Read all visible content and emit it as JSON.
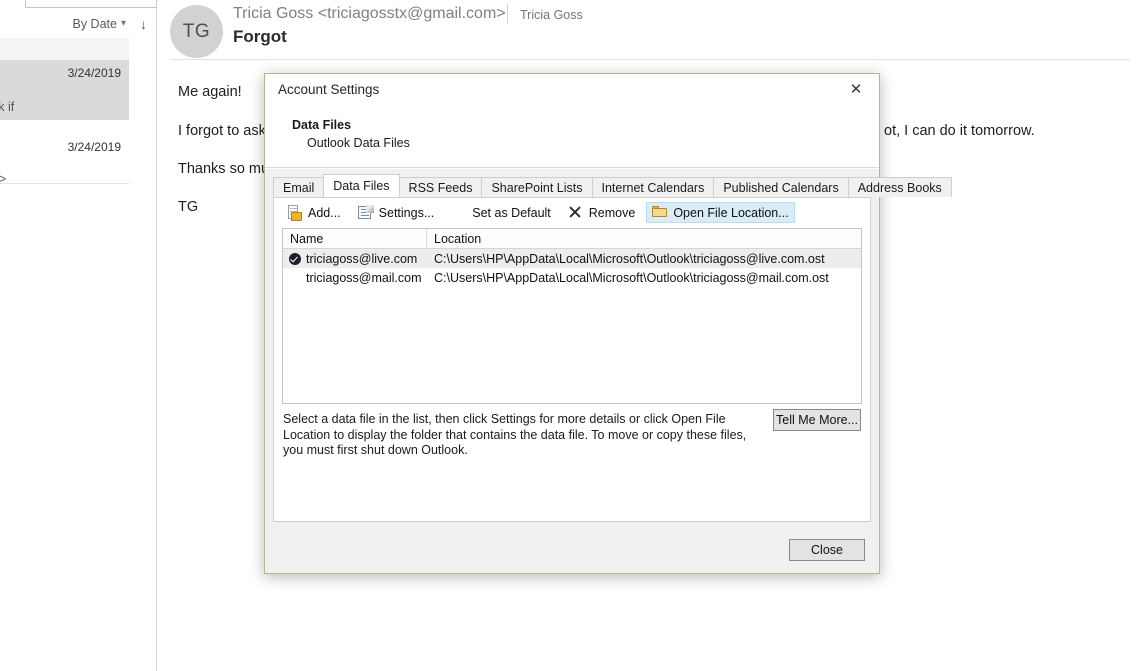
{
  "message_list": {
    "sort": {
      "label": "By Date",
      "chevron_icon": "chevron-down-icon",
      "direction_icon": "sort-descending-arrow-icon"
    },
    "items": [
      {
        "date": "3/24/2019",
        "snippet": "sk if",
        "selected": true
      },
      {
        "date": "3/24/2019",
        "snippet": "d>",
        "selected": false
      }
    ]
  },
  "reading_pane": {
    "avatar_initials": "TG",
    "from": "Tricia Goss <triciagosstx@gmail.com>",
    "from_short": "Tricia Goss",
    "subject": "Forgot",
    "body_lines": [
      "Me again!",
      "I forgot to ask",
      "Thanks so muc",
      "TG"
    ],
    "occluded_tail": "ot, I can do it tomorrow."
  },
  "dialog": {
    "title": "Account Settings",
    "close_icon": "close-icon",
    "banner": {
      "heading": "Data Files",
      "subtext": "Outlook Data Files"
    },
    "tabs": [
      {
        "label": "Email",
        "active": false
      },
      {
        "label": "Data Files",
        "active": true
      },
      {
        "label": "RSS Feeds",
        "active": false
      },
      {
        "label": "SharePoint Lists",
        "active": false
      },
      {
        "label": "Internet Calendars",
        "active": false
      },
      {
        "label": "Published Calendars",
        "active": false
      },
      {
        "label": "Address Books",
        "active": false
      }
    ],
    "commands": [
      {
        "label": "Add...",
        "icon": "add-data-file-icon",
        "highlight": false
      },
      {
        "label": "Settings...",
        "icon": "settings-page-icon",
        "highlight": false
      },
      {
        "label": "Set as Default",
        "icon": "check-circle-icon",
        "highlight": false
      },
      {
        "label": "Remove",
        "icon": "remove-x-icon",
        "highlight": false
      },
      {
        "label": "Open File Location...",
        "icon": "folder-icon",
        "highlight": true
      }
    ],
    "list": {
      "columns": [
        "Name",
        "Location"
      ],
      "rows": [
        {
          "name": "triciagoss@live.com",
          "location": "C:\\Users\\HP\\AppData\\Local\\Microsoft\\Outlook\\triciagoss@live.com.ost",
          "is_default": true,
          "selected": true
        },
        {
          "name": "triciagoss@mail.com",
          "location": "C:\\Users\\HP\\AppData\\Local\\Microsoft\\Outlook\\triciagoss@mail.com.ost",
          "is_default": false,
          "selected": false
        }
      ]
    },
    "help_text": "Select a data file in the list, then click Settings for more details or click Open File Location to display the folder that contains the data file. To move or copy these files, you must first shut down Outlook.",
    "tell_me_more_label": "Tell Me More...",
    "close_label": "Close",
    "accent_border_color": "#a6bf8f"
  }
}
